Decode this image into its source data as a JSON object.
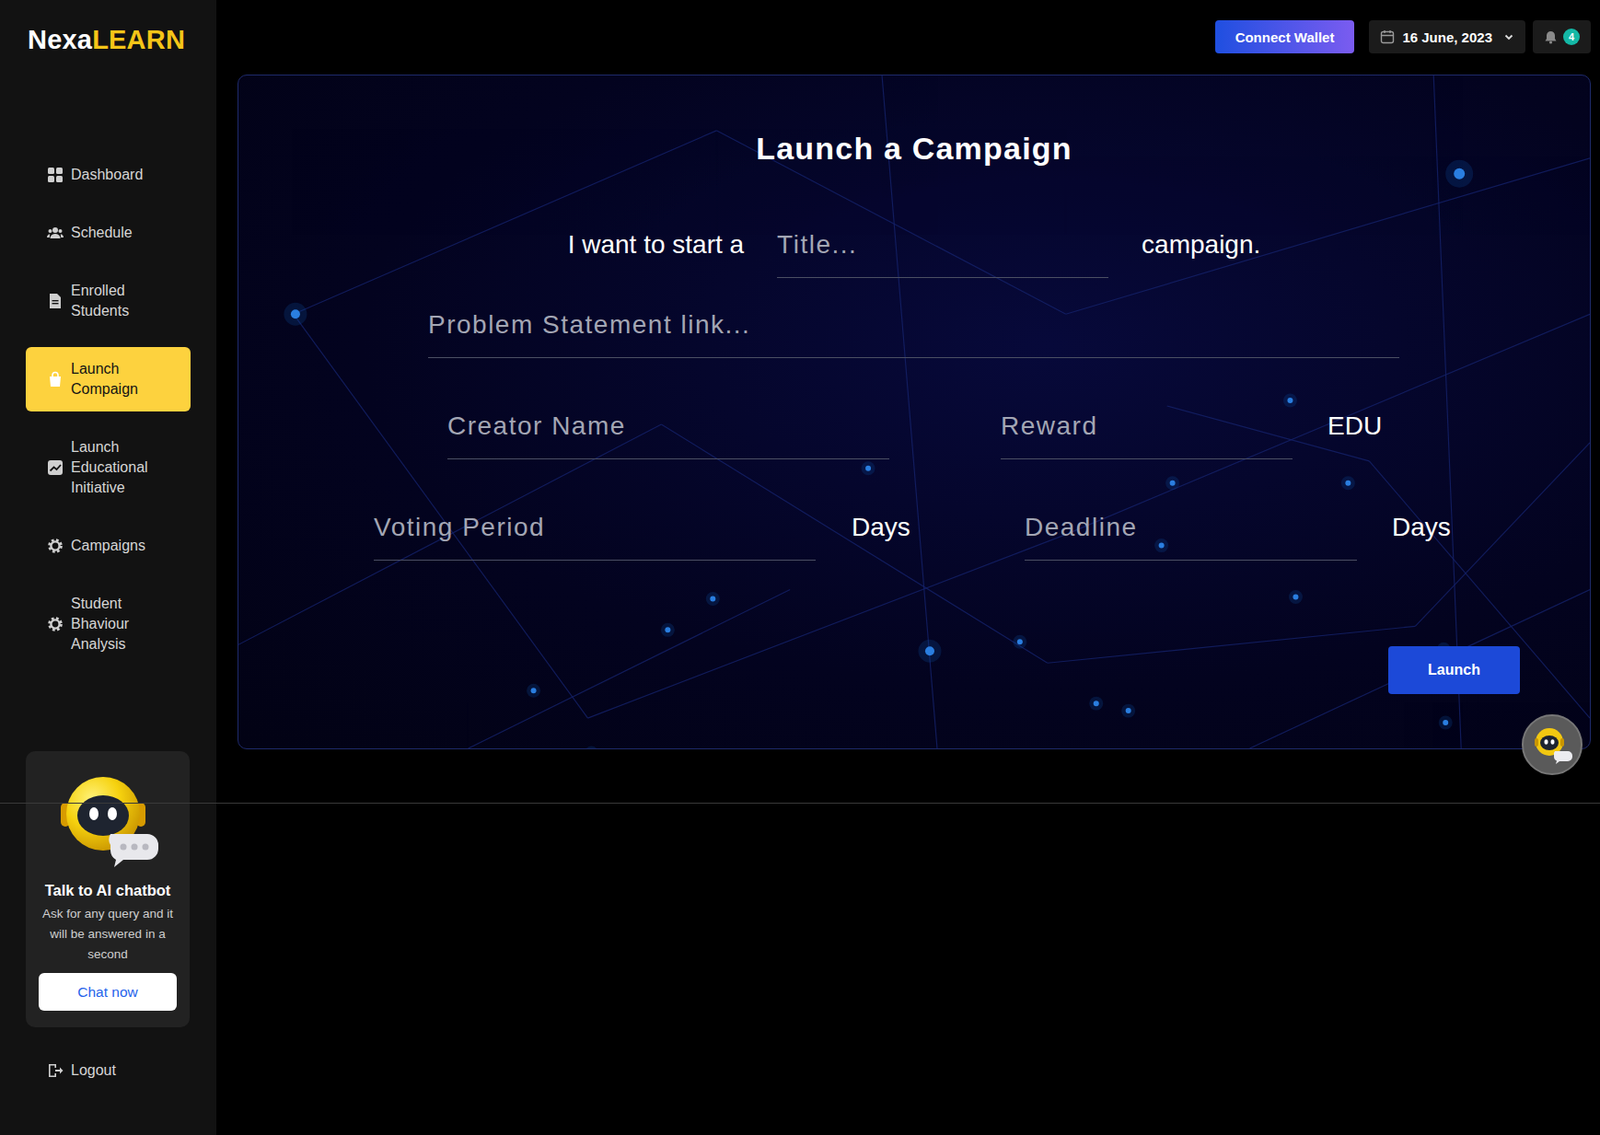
{
  "logo": {
    "prefix": "Nexa",
    "highlight": "LEARN"
  },
  "sidebar": {
    "items": [
      {
        "label": "Dashboard",
        "selected": false
      },
      {
        "label": "Schedule",
        "selected": false
      },
      {
        "label": "Enrolled Students",
        "selected": false
      },
      {
        "label": "Launch Compaign",
        "selected": true
      },
      {
        "label": "Launch Educational Initiative",
        "selected": false
      },
      {
        "label": "Campaigns",
        "selected": false
      },
      {
        "label": "Student Bhaviour Analysis",
        "selected": false
      }
    ],
    "chatbot": {
      "title": "Talk to AI chatbot",
      "description": "Ask for any query and it will be answered in a second",
      "button": "Chat now"
    },
    "logout": "Logout"
  },
  "topbar": {
    "wallet_button": "Connect Wallet",
    "date": "16 June, 2023",
    "notifications": "4"
  },
  "form": {
    "title": "Launch a Campaign",
    "sentence_before": "I want to start a",
    "title_placeholder": "Title...",
    "sentence_after": "campaign.",
    "problem_placeholder": "Problem Statement link...",
    "creator_placeholder": "Creator Name",
    "reward_placeholder": "Reward",
    "reward_unit": "EDU",
    "voting_placeholder": "Voting Period",
    "voting_unit": "Days",
    "deadline_placeholder": "Deadline",
    "deadline_unit": "Days",
    "submit": "Launch"
  }
}
